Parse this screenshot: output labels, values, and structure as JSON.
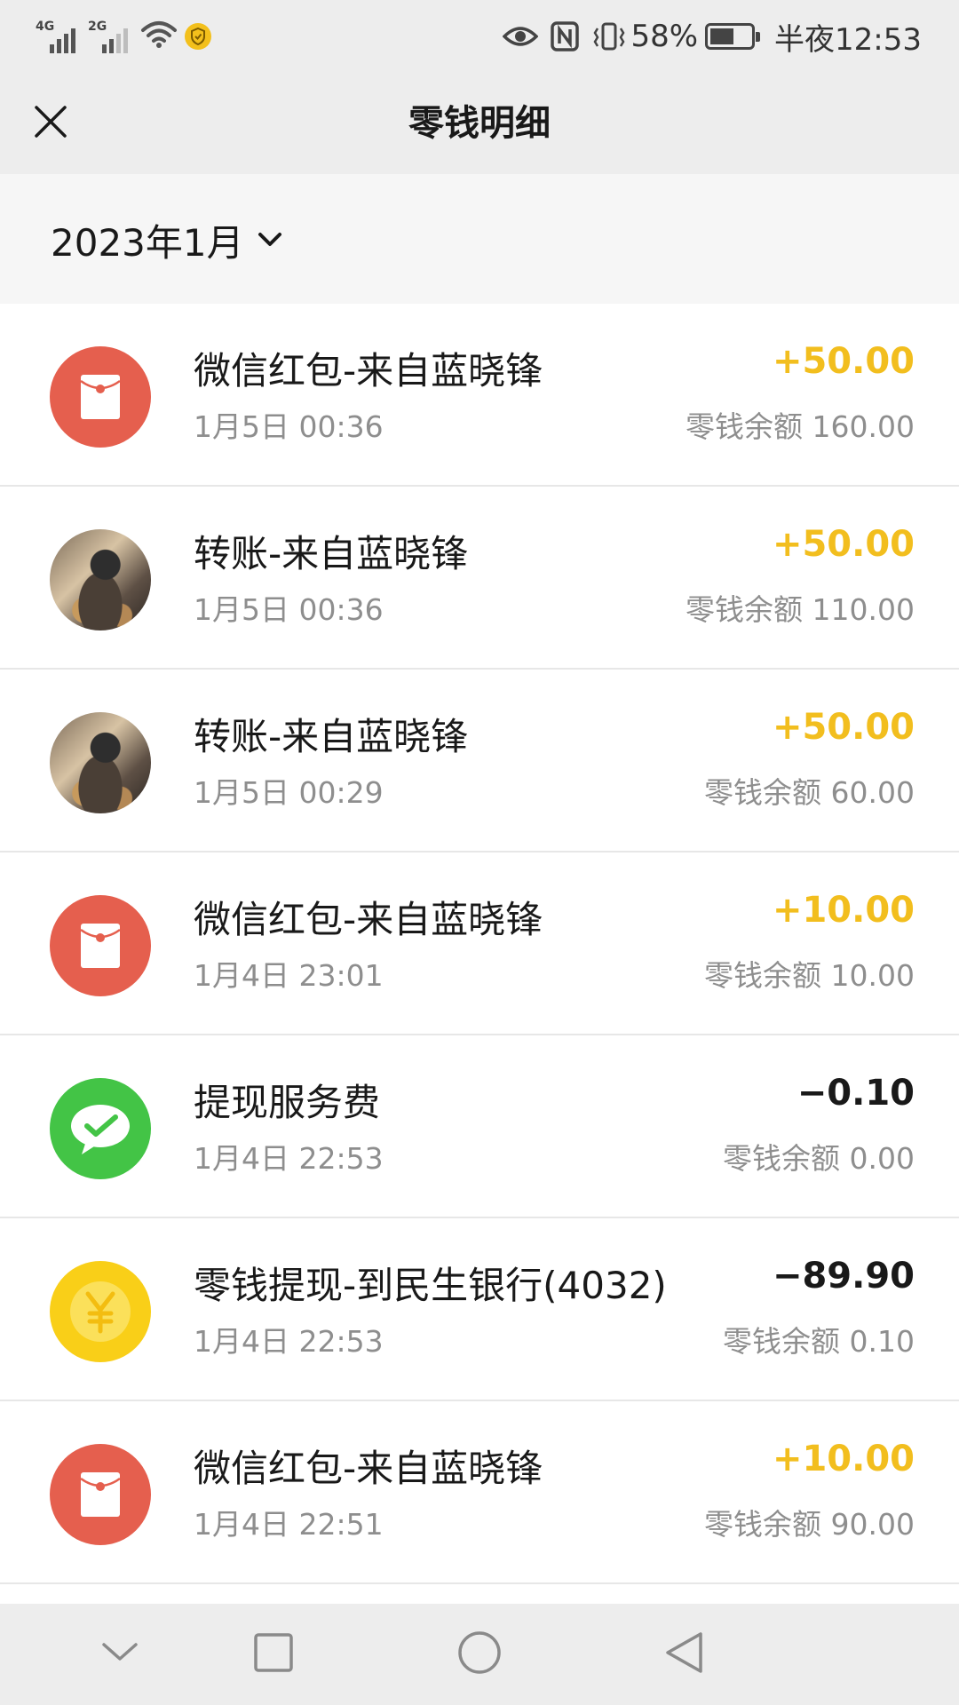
{
  "status_bar": {
    "signal1_label": "4G",
    "signal2_label": "2G",
    "battery_percent": "58%",
    "battery_level": 0.58,
    "time": "半夜12:53",
    "icons": [
      "signal-4g-icon",
      "signal-2g-icon",
      "wifi-icon",
      "shield-icon",
      "eye-icon",
      "nfc-icon",
      "vibrate-icon",
      "battery-icon"
    ]
  },
  "header": {
    "title": "零钱明细",
    "close_icon": "close-icon"
  },
  "filter": {
    "month": "2023年1月",
    "chevron_icon": "chevron-down-icon"
  },
  "transactions": [
    {
      "icon": "red-packet-icon",
      "title": "微信红包-来自蓝晓锋",
      "time": "1月5日 00:36",
      "amount": "+50.00",
      "balance": "零钱余额 160.00",
      "direction": "in"
    },
    {
      "icon": "avatar",
      "title": "转账-来自蓝晓锋",
      "time": "1月5日 00:36",
      "amount": "+50.00",
      "balance": "零钱余额 110.00",
      "direction": "in"
    },
    {
      "icon": "avatar",
      "title": "转账-来自蓝晓锋",
      "time": "1月5日 00:29",
      "amount": "+50.00",
      "balance": "零钱余额 60.00",
      "direction": "in"
    },
    {
      "icon": "red-packet-icon",
      "title": "微信红包-来自蓝晓锋",
      "time": "1月4日 23:01",
      "amount": "+10.00",
      "balance": "零钱余额 10.00",
      "direction": "in"
    },
    {
      "icon": "wechat-pay-icon",
      "title": "提现服务费",
      "time": "1月4日 22:53",
      "amount": "−0.10",
      "balance": "零钱余额 0.00",
      "direction": "out"
    },
    {
      "icon": "yuan-coin-icon",
      "title": "零钱提现-到民生银行(4032)",
      "time": "1月4日 22:53",
      "amount": "−89.90",
      "balance": "零钱余额 0.10",
      "direction": "out"
    },
    {
      "icon": "red-packet-icon",
      "title": "微信红包-来自蓝晓锋",
      "time": "1月4日 22:51",
      "amount": "+10.00",
      "balance": "零钱余额 90.00",
      "direction": "in"
    }
  ],
  "colors": {
    "income": "#f2be1e",
    "expense": "#191919",
    "red_packet": "#e55f4e",
    "wechat_green": "#43c446",
    "coin_yellow": "#f9cf18"
  },
  "nav_bar": {
    "icons": [
      "nav-down-icon",
      "recents-icon",
      "home-icon",
      "back-icon"
    ]
  }
}
